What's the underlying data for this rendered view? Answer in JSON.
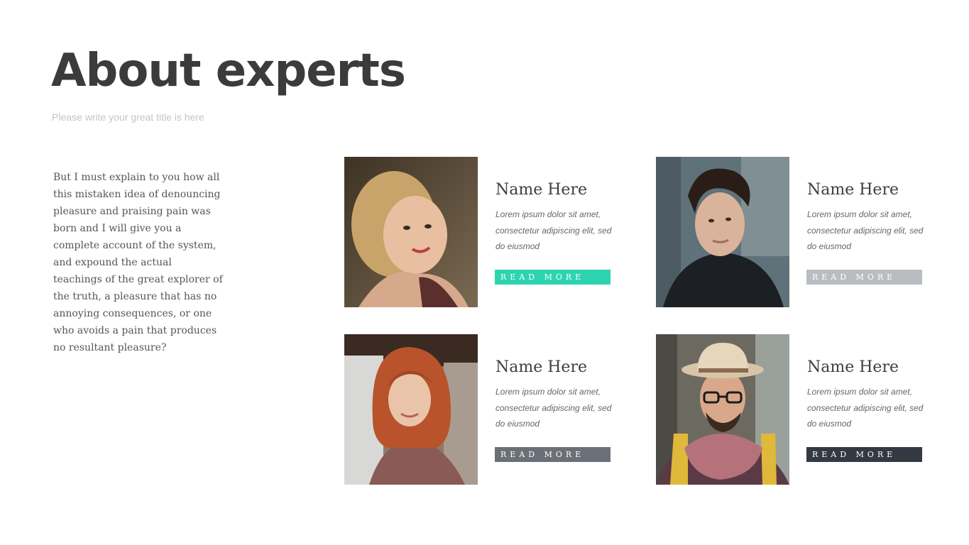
{
  "header": {
    "title": "About experts",
    "subtitle": "Please write your great title is here"
  },
  "intro": {
    "text": "But I must explain to you how all this mistaken idea of denouncing pleasure and praising pain was born and I will give you a complete account of the system, and expound the actual teachings of the great explorer of the truth, a pleasure that has no annoying consequences, or one who avoids a pain that produces no resultant pleasure?"
  },
  "experts": [
    {
      "name": "Name Here",
      "description": "Lorem ipsum dolor sit amet, consectetur adipiscing elit, sed do eiusmod",
      "button_label": "READ MORE",
      "button_color": "#2dd4b0"
    },
    {
      "name": "Name Here",
      "description": "Lorem ipsum dolor sit amet, consectetur adipiscing elit, sed do eiusmod",
      "button_label": "READ MORE",
      "button_color": "#b9bdc2"
    },
    {
      "name": "Name Here",
      "description": "Lorem ipsum dolor sit amet, consectetur adipiscing elit, sed do eiusmod",
      "button_label": "READ MORE",
      "button_color": "#6b7078"
    },
    {
      "name": "Name Here",
      "description": "Lorem ipsum dolor sit amet, consectetur adipiscing elit, sed do eiusmod",
      "button_label": "READ MORE",
      "button_color": "#343a42"
    }
  ]
}
